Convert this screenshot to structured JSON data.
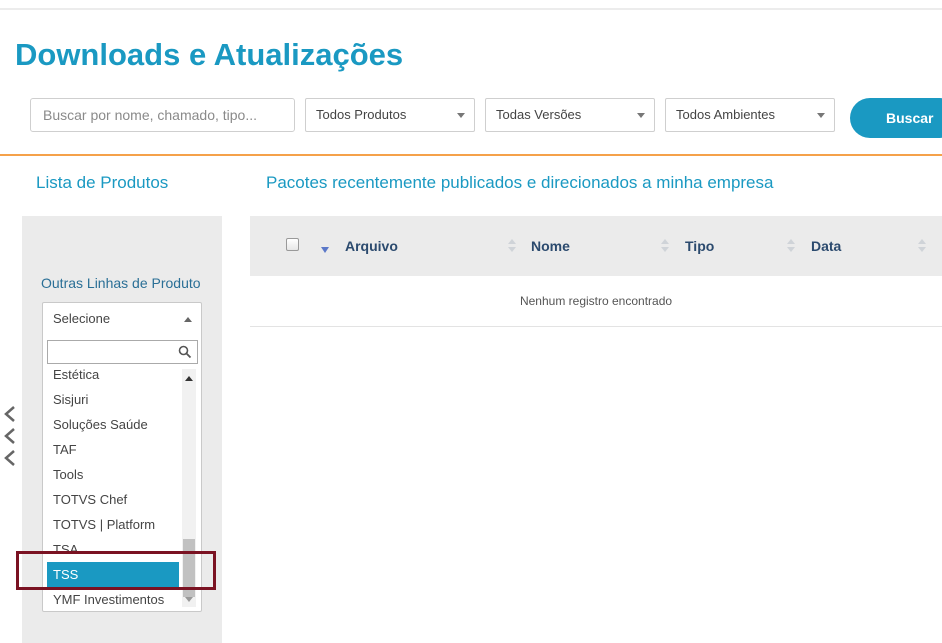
{
  "header": {
    "title": "Downloads e Atualizações"
  },
  "filters": {
    "search_placeholder": "Buscar por nome, chamado, tipo...",
    "products_selected": "Todos Produtos",
    "versions_selected": "Todas Versões",
    "environments_selected": "Todos Ambientes",
    "search_button": "Buscar"
  },
  "sidebar": {
    "title": "Lista de Produtos",
    "other_lines_label": "Outras Linhas de Produto",
    "select_value": "Selecione",
    "search_value": "",
    "items": [
      {
        "label": "Estética"
      },
      {
        "label": "Sisjuri"
      },
      {
        "label": "Soluções Saúde"
      },
      {
        "label": "TAF"
      },
      {
        "label": "Tools"
      },
      {
        "label": "TOTVS Chef"
      },
      {
        "label": "TOTVS | Platform"
      },
      {
        "label": "TSA"
      },
      {
        "label": "TSS",
        "selected": true
      },
      {
        "label": "YMF Investimentos"
      }
    ]
  },
  "main": {
    "title": "Pacotes recentemente publicados e direcionados a minha empresa",
    "columns": [
      "Arquivo",
      "Nome",
      "Tipo",
      "Data"
    ],
    "empty_message": "Nenhum registro encontrado"
  },
  "colors": {
    "accent": "#1a99c2",
    "divider": "#f5a14a",
    "highlight": "#7a1222"
  }
}
